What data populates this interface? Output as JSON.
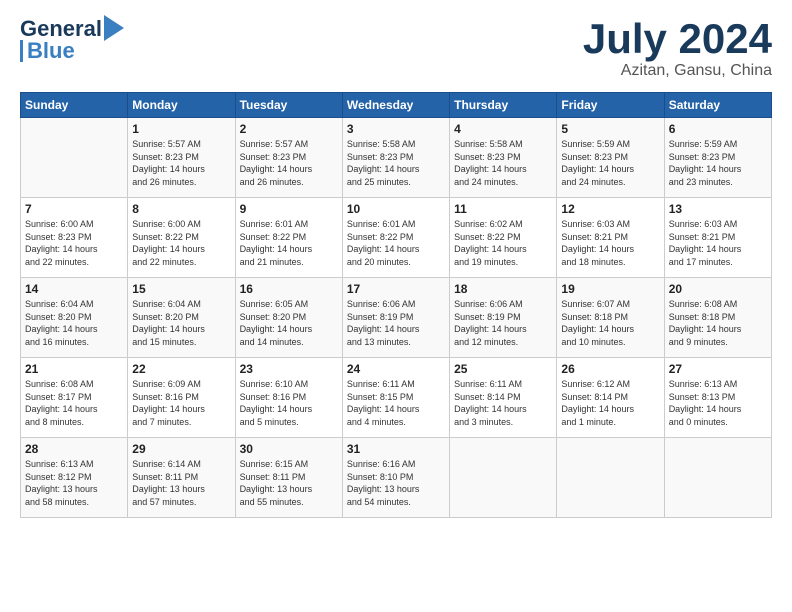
{
  "header": {
    "logo_text1": "General",
    "logo_text2": "Blue",
    "cal_title": "July 2024",
    "cal_subtitle": "Azitan, Gansu, China"
  },
  "weekdays": [
    "Sunday",
    "Monday",
    "Tuesday",
    "Wednesday",
    "Thursday",
    "Friday",
    "Saturday"
  ],
  "weeks": [
    [
      {
        "day": "",
        "info": ""
      },
      {
        "day": "1",
        "info": "Sunrise: 5:57 AM\nSunset: 8:23 PM\nDaylight: 14 hours\nand 26 minutes."
      },
      {
        "day": "2",
        "info": "Sunrise: 5:57 AM\nSunset: 8:23 PM\nDaylight: 14 hours\nand 26 minutes."
      },
      {
        "day": "3",
        "info": "Sunrise: 5:58 AM\nSunset: 8:23 PM\nDaylight: 14 hours\nand 25 minutes."
      },
      {
        "day": "4",
        "info": "Sunrise: 5:58 AM\nSunset: 8:23 PM\nDaylight: 14 hours\nand 24 minutes."
      },
      {
        "day": "5",
        "info": "Sunrise: 5:59 AM\nSunset: 8:23 PM\nDaylight: 14 hours\nand 24 minutes."
      },
      {
        "day": "6",
        "info": "Sunrise: 5:59 AM\nSunset: 8:23 PM\nDaylight: 14 hours\nand 23 minutes."
      }
    ],
    [
      {
        "day": "7",
        "info": "Sunrise: 6:00 AM\nSunset: 8:23 PM\nDaylight: 14 hours\nand 22 minutes."
      },
      {
        "day": "8",
        "info": "Sunrise: 6:00 AM\nSunset: 8:22 PM\nDaylight: 14 hours\nand 22 minutes."
      },
      {
        "day": "9",
        "info": "Sunrise: 6:01 AM\nSunset: 8:22 PM\nDaylight: 14 hours\nand 21 minutes."
      },
      {
        "day": "10",
        "info": "Sunrise: 6:01 AM\nSunset: 8:22 PM\nDaylight: 14 hours\nand 20 minutes."
      },
      {
        "day": "11",
        "info": "Sunrise: 6:02 AM\nSunset: 8:22 PM\nDaylight: 14 hours\nand 19 minutes."
      },
      {
        "day": "12",
        "info": "Sunrise: 6:03 AM\nSunset: 8:21 PM\nDaylight: 14 hours\nand 18 minutes."
      },
      {
        "day": "13",
        "info": "Sunrise: 6:03 AM\nSunset: 8:21 PM\nDaylight: 14 hours\nand 17 minutes."
      }
    ],
    [
      {
        "day": "14",
        "info": "Sunrise: 6:04 AM\nSunset: 8:20 PM\nDaylight: 14 hours\nand 16 minutes."
      },
      {
        "day": "15",
        "info": "Sunrise: 6:04 AM\nSunset: 8:20 PM\nDaylight: 14 hours\nand 15 minutes."
      },
      {
        "day": "16",
        "info": "Sunrise: 6:05 AM\nSunset: 8:20 PM\nDaylight: 14 hours\nand 14 minutes."
      },
      {
        "day": "17",
        "info": "Sunrise: 6:06 AM\nSunset: 8:19 PM\nDaylight: 14 hours\nand 13 minutes."
      },
      {
        "day": "18",
        "info": "Sunrise: 6:06 AM\nSunset: 8:19 PM\nDaylight: 14 hours\nand 12 minutes."
      },
      {
        "day": "19",
        "info": "Sunrise: 6:07 AM\nSunset: 8:18 PM\nDaylight: 14 hours\nand 10 minutes."
      },
      {
        "day": "20",
        "info": "Sunrise: 6:08 AM\nSunset: 8:18 PM\nDaylight: 14 hours\nand 9 minutes."
      }
    ],
    [
      {
        "day": "21",
        "info": "Sunrise: 6:08 AM\nSunset: 8:17 PM\nDaylight: 14 hours\nand 8 minutes."
      },
      {
        "day": "22",
        "info": "Sunrise: 6:09 AM\nSunset: 8:16 PM\nDaylight: 14 hours\nand 7 minutes."
      },
      {
        "day": "23",
        "info": "Sunrise: 6:10 AM\nSunset: 8:16 PM\nDaylight: 14 hours\nand 5 minutes."
      },
      {
        "day": "24",
        "info": "Sunrise: 6:11 AM\nSunset: 8:15 PM\nDaylight: 14 hours\nand 4 minutes."
      },
      {
        "day": "25",
        "info": "Sunrise: 6:11 AM\nSunset: 8:14 PM\nDaylight: 14 hours\nand 3 minutes."
      },
      {
        "day": "26",
        "info": "Sunrise: 6:12 AM\nSunset: 8:14 PM\nDaylight: 14 hours\nand 1 minute."
      },
      {
        "day": "27",
        "info": "Sunrise: 6:13 AM\nSunset: 8:13 PM\nDaylight: 14 hours\nand 0 minutes."
      }
    ],
    [
      {
        "day": "28",
        "info": "Sunrise: 6:13 AM\nSunset: 8:12 PM\nDaylight: 13 hours\nand 58 minutes."
      },
      {
        "day": "29",
        "info": "Sunrise: 6:14 AM\nSunset: 8:11 PM\nDaylight: 13 hours\nand 57 minutes."
      },
      {
        "day": "30",
        "info": "Sunrise: 6:15 AM\nSunset: 8:11 PM\nDaylight: 13 hours\nand 55 minutes."
      },
      {
        "day": "31",
        "info": "Sunrise: 6:16 AM\nSunset: 8:10 PM\nDaylight: 13 hours\nand 54 minutes."
      },
      {
        "day": "",
        "info": ""
      },
      {
        "day": "",
        "info": ""
      },
      {
        "day": "",
        "info": ""
      }
    ]
  ]
}
